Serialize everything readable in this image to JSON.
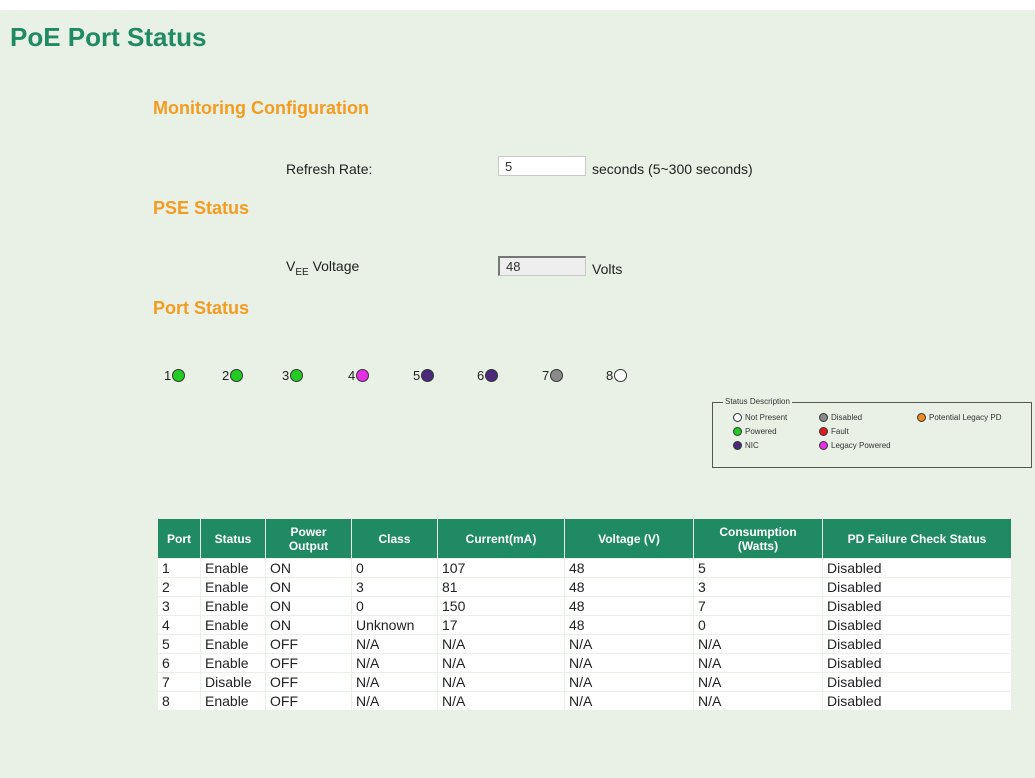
{
  "page_title": "PoE Port Status",
  "monitoring": {
    "title": "Monitoring Configuration",
    "refresh_label": "Refresh Rate:",
    "refresh_value": "5",
    "refresh_unit": "seconds (5~300 seconds)"
  },
  "pse": {
    "title": "PSE Status",
    "voltage_label_main": "V",
    "voltage_label_sub": "EE",
    "voltage_label_rest": " Voltage",
    "voltage_value": "48",
    "voltage_unit": "Volts"
  },
  "port_status": {
    "title": "Port Status",
    "ports": [
      {
        "num": "1",
        "status": "Powered",
        "color": "#22cc22"
      },
      {
        "num": "2",
        "status": "Powered",
        "color": "#22cc22"
      },
      {
        "num": "3",
        "status": "Powered",
        "color": "#22cc22"
      },
      {
        "num": "4",
        "status": "Legacy Powered",
        "color": "#e62ee6"
      },
      {
        "num": "5",
        "status": "NIC",
        "color": "#4b2a7a"
      },
      {
        "num": "6",
        "status": "NIC",
        "color": "#4b2a7a"
      },
      {
        "num": "7",
        "status": "Disabled",
        "color": "#8a8a8a"
      },
      {
        "num": "8",
        "status": "Not Present",
        "color": "#ffffff"
      }
    ]
  },
  "legend": {
    "title": "Status Description",
    "items": [
      {
        "label": "Not Present",
        "color": "#ffffff"
      },
      {
        "label": "Disabled",
        "color": "#8a8a8a"
      },
      {
        "label": "Potential Legacy PD",
        "color": "#f08a1f"
      },
      {
        "label": "Powered",
        "color": "#22cc22"
      },
      {
        "label": "Fault",
        "color": "#e01b1b"
      },
      {
        "label": "NIC",
        "color": "#4b2a7a"
      },
      {
        "label": "Legacy Powered",
        "color": "#e62ee6"
      }
    ]
  },
  "table": {
    "headers": [
      "Port",
      "Status",
      "Power Output",
      "Class",
      "Current(mA)",
      "Voltage (V)",
      "Consumption (Watts)",
      "PD Failure Check Status"
    ],
    "rows": [
      [
        "1",
        "Enable",
        "ON",
        "0",
        "107",
        "48",
        "5",
        "Disabled"
      ],
      [
        "2",
        "Enable",
        "ON",
        "3",
        "81",
        "48",
        "3",
        "Disabled"
      ],
      [
        "3",
        "Enable",
        "ON",
        "0",
        "150",
        "48",
        "7",
        "Disabled"
      ],
      [
        "4",
        "Enable",
        "ON",
        "Unknown",
        "17",
        "48",
        "0",
        "Disabled"
      ],
      [
        "5",
        "Enable",
        "OFF",
        "N/A",
        "N/A",
        "N/A",
        "N/A",
        "Disabled"
      ],
      [
        "6",
        "Enable",
        "OFF",
        "N/A",
        "N/A",
        "N/A",
        "N/A",
        "Disabled"
      ],
      [
        "7",
        "Disable",
        "OFF",
        "N/A",
        "N/A",
        "N/A",
        "N/A",
        "Disabled"
      ],
      [
        "8",
        "Enable",
        "OFF",
        "N/A",
        "N/A",
        "N/A",
        "N/A",
        "Disabled"
      ]
    ]
  }
}
